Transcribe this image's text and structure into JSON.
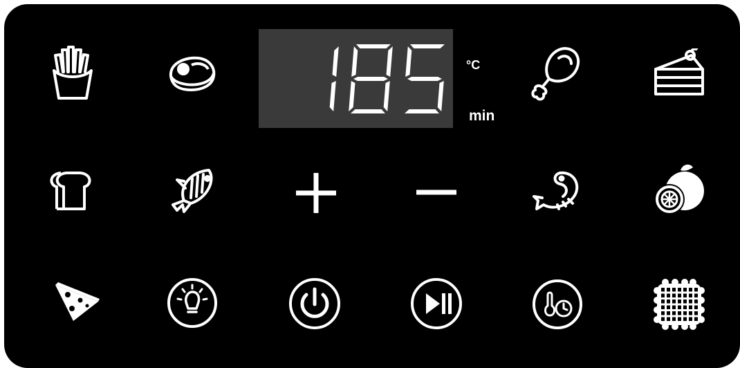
{
  "display": {
    "value": "185",
    "unit_temp": "°C",
    "unit_time": "min"
  },
  "colors": {
    "panel": "#000000",
    "display_bg": "#3a3a3a",
    "segment_on": "#ffffff",
    "icon": "#ffffff"
  },
  "buttons": {
    "row1": [
      "fries-icon",
      "steak-icon",
      "chicken-drumstick-icon",
      "cake-icon"
    ],
    "row2": [
      "bread-icon",
      "fish-icon",
      "plus-icon",
      "minus-icon",
      "shrimp-icon",
      "fruit-icon"
    ],
    "row3": [
      "pizza-icon",
      "light-icon",
      "power-icon",
      "play-pause-icon",
      "temp-timer-icon",
      "waffle-icon"
    ]
  }
}
